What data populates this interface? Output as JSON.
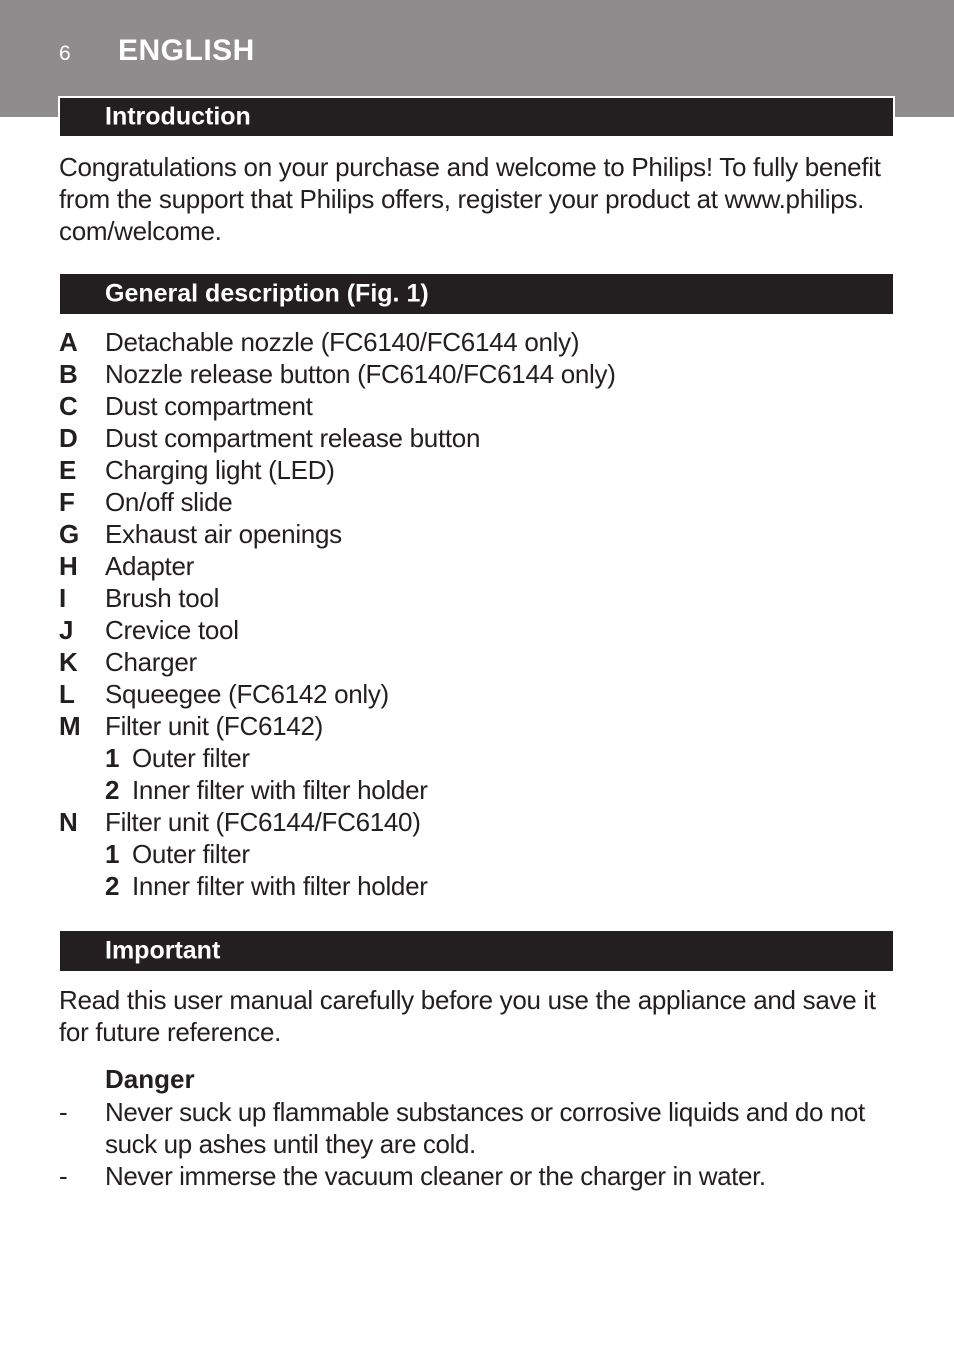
{
  "header": {
    "page_number": "6",
    "language": "ENGLISH"
  },
  "colors": {
    "header_band": "#8e8c8d",
    "section_bar": "#231f20",
    "text": "#231f20",
    "bar_text": "#ffffff"
  },
  "introduction": {
    "title": "Introduction",
    "lines": [
      "Congratulations on your purchase and welcome to Philips! To fully benefit",
      "from the support that Philips offers, register your product at www.philips.",
      "com/welcome."
    ]
  },
  "general_description": {
    "title": "General description (Fig. 1)",
    "items": [
      {
        "letter": "A",
        "text": "Detachable nozzle (FC6140/FC6144 only)"
      },
      {
        "letter": "B",
        "text": "Nozzle release button (FC6140/FC6144 only)"
      },
      {
        "letter": "C",
        "text": "Dust compartment"
      },
      {
        "letter": "D",
        "text": "Dust compartment release button"
      },
      {
        "letter": "E",
        "text": "Charging light (LED)"
      },
      {
        "letter": "F",
        "text": "On/off slide"
      },
      {
        "letter": "G",
        "text": "Exhaust air openings"
      },
      {
        "letter": "H",
        "text": "Adapter"
      },
      {
        "letter": "I",
        "text": "Brush tool"
      },
      {
        "letter": "J",
        "text": "Crevice tool"
      },
      {
        "letter": "K",
        "text": "Charger"
      },
      {
        "letter": "L",
        "text": "Squeegee (FC6142 only)"
      },
      {
        "letter": "M",
        "text": "Filter unit (FC6142)"
      },
      {
        "num": "1",
        "text": "Outer filter"
      },
      {
        "num": "2",
        "text": "Inner filter with filter holder"
      },
      {
        "letter": "N",
        "text": "Filter unit (FC6144/FC6140)"
      },
      {
        "num": "1",
        "text": "Outer filter"
      },
      {
        "num": "2",
        "text": "Inner filter with filter holder"
      }
    ]
  },
  "important": {
    "title": "Important",
    "lines": [
      "Read this user manual carefully before you use the appliance and save it",
      "for future reference."
    ],
    "danger": {
      "heading": "Danger",
      "bullets": [
        {
          "dash": "-",
          "lines": [
            "Never suck up flammable substances or corrosive liquids and do not",
            "suck up ashes until they are cold."
          ]
        },
        {
          "dash": "-",
          "lines": [
            "Never immerse the vacuum cleaner or the charger in water."
          ]
        }
      ]
    }
  }
}
